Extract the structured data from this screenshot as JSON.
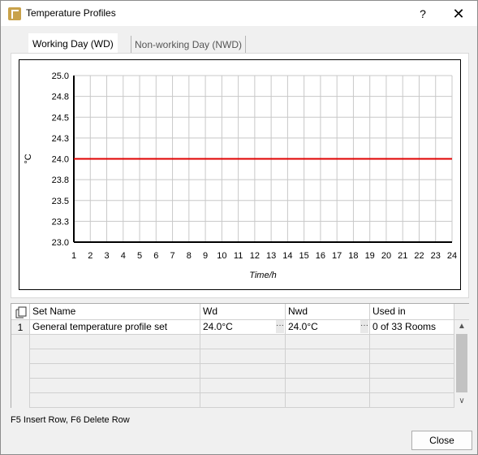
{
  "window": {
    "title": "Temperature Profiles",
    "help_label": "?",
    "close_glyph": "✕"
  },
  "tabs": [
    {
      "label": "Working Day (WD)",
      "selected": true
    },
    {
      "label": "Non-working Day (NWD)",
      "selected": false
    }
  ],
  "chart_data": {
    "type": "line",
    "title": "",
    "xlabel": "Time/h",
    "ylabel": "°C",
    "xlim": [
      1,
      24
    ],
    "ylim": [
      23.0,
      25.0
    ],
    "x_ticks": [
      1,
      2,
      3,
      4,
      5,
      6,
      7,
      8,
      9,
      10,
      11,
      12,
      13,
      14,
      15,
      16,
      17,
      18,
      19,
      20,
      21,
      22,
      23,
      24
    ],
    "y_ticks": [
      "23.0",
      "23.3",
      "23.5",
      "23.8",
      "24.0",
      "24.3",
      "24.5",
      "24.8",
      "25.0"
    ],
    "y_tick_values": [
      23.0,
      23.25,
      23.5,
      23.75,
      24.0,
      24.25,
      24.5,
      24.75,
      25.0
    ],
    "grid": true,
    "series": [
      {
        "color": "#e00000",
        "x": [
          1,
          24
        ],
        "y": [
          24.0,
          24.0
        ]
      }
    ]
  },
  "table": {
    "columns": [
      "Set Name",
      "Wd",
      "Nwd",
      "Used in"
    ],
    "rows": [
      {
        "num": "1",
        "set_name": "General temperature profile set",
        "wd": "24.0°C",
        "nwd": "24.0°C",
        "used_in": "0 of 33 Rooms"
      }
    ],
    "ellipsis": "···"
  },
  "status_hint": "F5 Insert Row, F6 Delete Row",
  "buttons": {
    "close": "Close"
  },
  "icons": {
    "app": "app-icon",
    "copy": "copy-icon",
    "scroll_up": "▲",
    "scroll_down": "∨"
  }
}
